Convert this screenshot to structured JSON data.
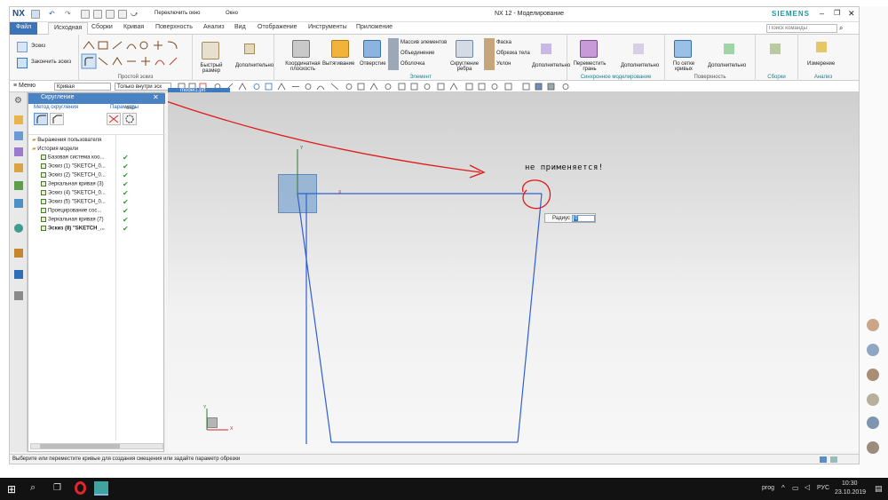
{
  "titlebar": {
    "app_logo": "NX",
    "switch_window": "Переключить окно",
    "window_menu": "Окно",
    "title": "NX 12 - Моделирование",
    "brand": "SIEMENS"
  },
  "tabs": [
    "Файл",
    "Исходная",
    "Сборки",
    "Кривая",
    "Поверхность",
    "Анализ",
    "Вид",
    "Отображение",
    "Инструменты",
    "Приложение"
  ],
  "search": {
    "placeholder": "Поиск команды"
  },
  "ribbon": {
    "sketch_label": "Эскиз",
    "finish_sketch_label": "Закончить эскиз",
    "simple_sketch_group": "Простой эскиз",
    "quick_dim": "Быстрый размер",
    "additional": "Дополнительно",
    "datum_plane": "Координатная плоскость",
    "extrude": "Вытягивание",
    "hole": "Отверстие",
    "pattern_feature": "Массив элементов",
    "unite": "Объединение",
    "shell": "Оболочка",
    "edge_blend": "Скругление ребра",
    "chamfer": "Фаска",
    "trim_body": "Обрезка тела",
    "draft": "Уклон",
    "element_group": "Элемент",
    "move_face": "Переместить грань",
    "sync_group": "Синхронное моделирование",
    "through_curves": "По сетке кривых",
    "surface_group": "Поверхность",
    "assemblies_group": "Сборки",
    "measure": "Измерение",
    "analysis_group": "Анализ"
  },
  "toolbar": {
    "menu": "Меню",
    "filter": "Кривая",
    "scope": "Только внутри эск"
  },
  "navigator": {
    "title": "Скругление",
    "fillet_method": "Метод скругления",
    "parameters": "Параметры",
    "column_header": "оно",
    "user_expressions": "Выражения пользователя",
    "model_history": "История модели",
    "items": [
      {
        "label": "Базовая система коо...",
        "bold": false
      },
      {
        "label": "Эскиз (1) \"SKETCH_0...",
        "bold": false
      },
      {
        "label": "Эскиз (2) \"SKETCH_0...",
        "bold": false
      },
      {
        "label": "Зеркальная кривая (3)",
        "bold": false
      },
      {
        "label": "Эскиз (4) \"SKETCH_0...",
        "bold": false
      },
      {
        "label": "Эскиз (5) \"SKETCH_0...",
        "bold": false
      },
      {
        "label": "Проецирование сос...",
        "bold": false
      },
      {
        "label": "Зеркальная кривая (7)",
        "bold": false
      },
      {
        "label": "Эскиз (8) \"SKETCH_...",
        "bold": true
      }
    ]
  },
  "graphics": {
    "tab_label": "model1.prt",
    "annotation": "не применяется!",
    "radius_label": "Радиус",
    "radius_value": "0",
    "x_axis": "X",
    "y_axis": "Y"
  },
  "status": {
    "message": "Выберите или переместите кривые для создания смещения или задайте параметр обрезки"
  },
  "taskbar": {
    "user": "prog",
    "language": "РУС",
    "time": "10:30",
    "date": "23.10.2019"
  },
  "colors": {
    "sketch_line": "#2f5fd0",
    "annotation": "#e01818",
    "accent": "#3b74b8"
  }
}
